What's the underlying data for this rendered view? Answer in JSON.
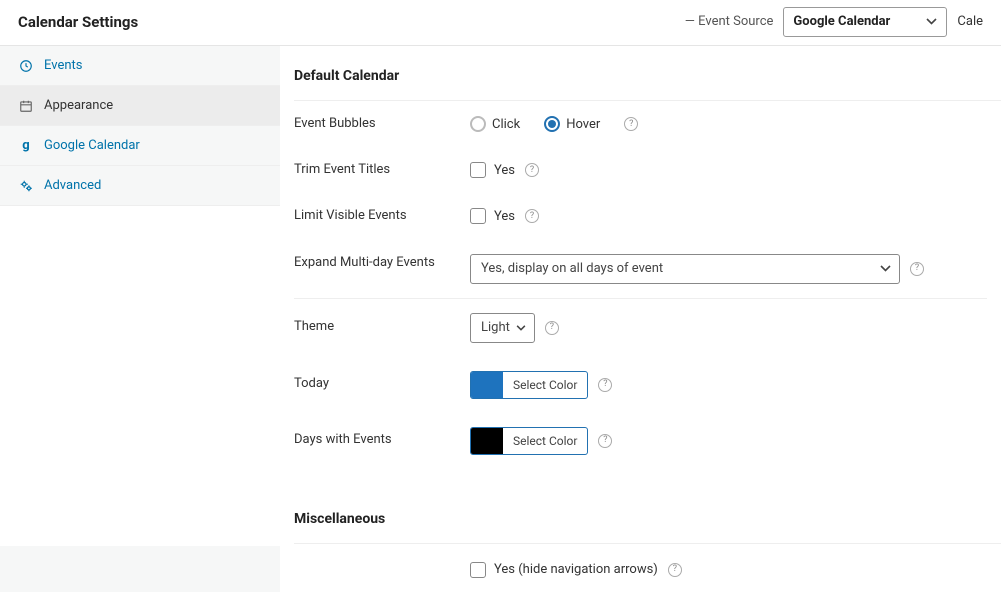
{
  "header": {
    "title": "Calendar Settings",
    "event_source_label": "— Event Source",
    "source_select": "Google Calendar",
    "truncated": "Cale"
  },
  "sidebar": {
    "events": "Events",
    "appearance": "Appearance",
    "google_cal": "Google Calendar",
    "advanced": "Advanced"
  },
  "main": {
    "default_calendar": "Default Calendar",
    "event_bubbles": {
      "label": "Event Bubbles",
      "click": "Click",
      "hover": "Hover"
    },
    "trim": {
      "label": "Trim Event Titles",
      "yes": "Yes"
    },
    "limit": {
      "label": "Limit Visible Events",
      "yes": "Yes"
    },
    "expand": {
      "label": "Expand Multi-day Events",
      "value": "Yes, display on all days of event"
    },
    "theme": {
      "label": "Theme",
      "value": "Light"
    },
    "today": {
      "label": "Today",
      "button": "Select Color"
    },
    "days_with": {
      "label": "Days with Events",
      "button": "Select Color"
    },
    "misc": "Miscellaneous",
    "static_cut": {
      "label": "",
      "yes": "Yes (hide navigation arrows)"
    }
  },
  "help": "?"
}
